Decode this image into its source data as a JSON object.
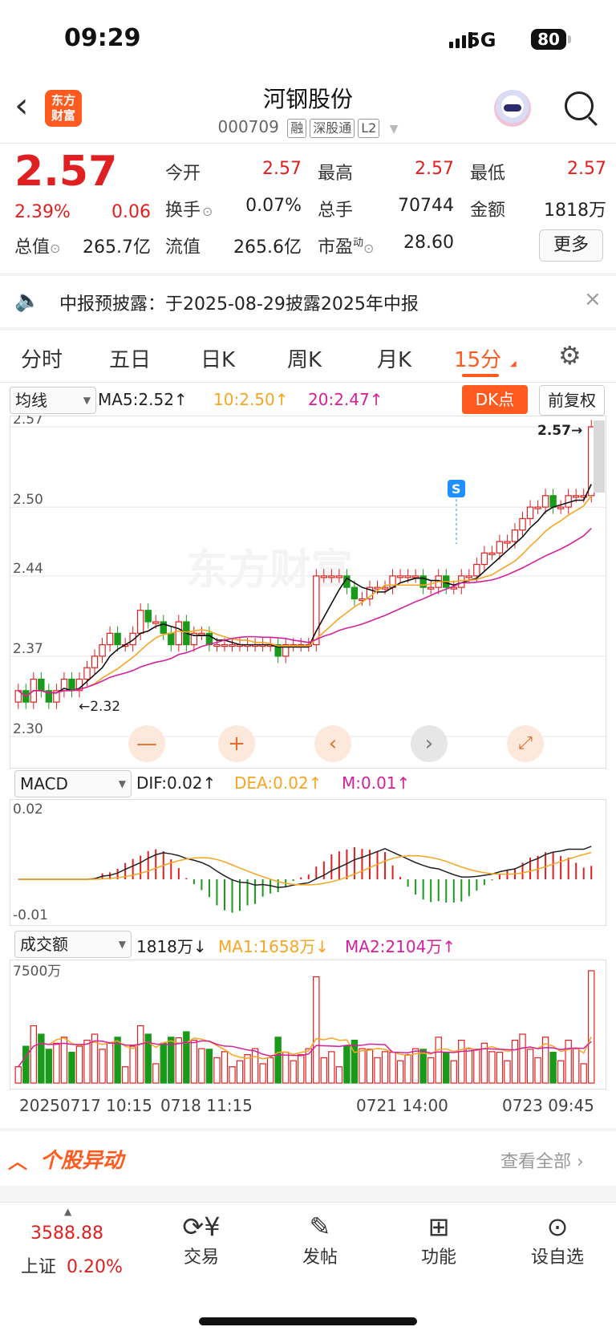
{
  "status_bar": {
    "time": "09:29",
    "network": "5G",
    "battery": "80"
  },
  "header": {
    "logo_text": "东方财富",
    "title": "河钢股份",
    "code": "000709",
    "tags": [
      "融",
      "深股通",
      "L2"
    ]
  },
  "quote": {
    "price": "2.57",
    "change_pct": "2.39%",
    "change": "0.06",
    "fields": [
      {
        "label": "今开",
        "value": "2.57"
      },
      {
        "label": "最高",
        "value": "2.57"
      },
      {
        "label": "最低",
        "value": "2.57"
      },
      {
        "label": "换手",
        "value": "0.07%"
      },
      {
        "label": "总手",
        "value": "70744"
      },
      {
        "label": "金额",
        "value": "1818万"
      },
      {
        "label": "总值",
        "value": "265.7亿"
      },
      {
        "label": "流值",
        "value": "265.6亿"
      },
      {
        "label": "市盈",
        "label_sup": "动",
        "value": "28.60"
      }
    ],
    "more_label": "更多"
  },
  "notice": {
    "text": "中报预披露：于2025-08-29披露2025年中报"
  },
  "tabs": [
    "分时",
    "五日",
    "日K",
    "周K",
    "月K",
    "15分"
  ],
  "active_tab": "15分",
  "kline": {
    "indicator_select": "均线",
    "ma5": "MA5:2.52↑",
    "ma10": "10:2.50↑",
    "ma20": "20:2.47↑",
    "dk_label": "DK点",
    "fq_label": "前复权",
    "y_ticks": [
      "2.57",
      "2.50",
      "2.44",
      "2.37",
      "2.30"
    ],
    "last_label": "2.57→",
    "low_label": "←2.32",
    "signal": "S",
    "watermark": "东方财富"
  },
  "macd": {
    "select": "MACD",
    "dif": "DIF:0.02↑",
    "dea": "DEA:0.02↑",
    "m": "M:0.01↑",
    "y_ticks": [
      "0.02",
      "-0.01"
    ]
  },
  "volume": {
    "select": "成交额",
    "value": "1818万↓",
    "ma1": "MA1:1658万↓",
    "ma2": "MA2:2104万↑",
    "y_tick": "7500万"
  },
  "x_labels": [
    "20250717 10:15",
    "0718 11:15",
    "0721 14:00",
    "0723 09:45"
  ],
  "section": {
    "title": "个股异动",
    "link": "查看全部"
  },
  "bottom_nav": {
    "index_value": "3588.88",
    "index_name": "上证",
    "index_pct": "0.20%",
    "items": [
      "交易",
      "发帖",
      "功能",
      "设自选"
    ]
  },
  "colors": {
    "up": "#e02020",
    "down": "#1a9a1a",
    "accent": "#ff5a1f",
    "ma10": "#f5a623",
    "ma20": "#d4209c"
  },
  "chart_data": {
    "type": "candlestick",
    "x_labels": [
      "20250717 10:15",
      "0718 11:15",
      "0721 14:00",
      "0723 09:45"
    ],
    "ylim": [
      2.3,
      2.57
    ],
    "close": [
      2.34,
      2.33,
      2.35,
      2.34,
      2.33,
      2.34,
      2.35,
      2.34,
      2.35,
      2.36,
      2.37,
      2.38,
      2.39,
      2.38,
      2.38,
      2.39,
      2.41,
      2.4,
      2.4,
      2.39,
      2.38,
      2.4,
      2.38,
      2.39,
      2.39,
      2.38,
      2.38,
      2.38,
      2.38,
      2.38,
      2.38,
      2.38,
      2.38,
      2.38,
      2.37,
      2.38,
      2.38,
      2.38,
      2.38,
      2.44,
      2.44,
      2.44,
      2.44,
      2.43,
      2.42,
      2.42,
      2.43,
      2.43,
      2.43,
      2.44,
      2.44,
      2.44,
      2.44,
      2.43,
      2.43,
      2.44,
      2.43,
      2.43,
      2.44,
      2.44,
      2.45,
      2.46,
      2.46,
      2.47,
      2.47,
      2.48,
      2.49,
      2.5,
      2.5,
      2.51,
      2.5,
      2.5,
      2.51,
      2.51,
      2.51,
      2.57
    ]
  }
}
